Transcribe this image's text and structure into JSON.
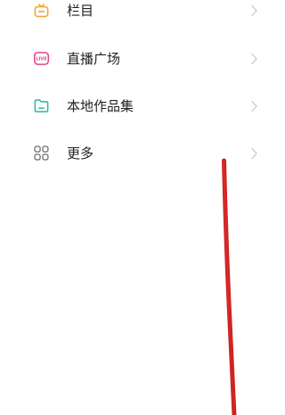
{
  "menu": {
    "items": [
      {
        "label": "栏目",
        "icon": "tv-column-icon",
        "color": "#f0a830"
      },
      {
        "label": "直播广场",
        "icon": "live-icon",
        "color": "#e0468a"
      },
      {
        "label": "本地作品集",
        "icon": "folder-icon",
        "color": "#2cb89a"
      },
      {
        "label": "更多",
        "icon": "grid-more-icon",
        "color": "#777777"
      }
    ]
  },
  "colors": {
    "chevron": "#c8c8c8",
    "annotation_stroke": "#cc1010"
  }
}
